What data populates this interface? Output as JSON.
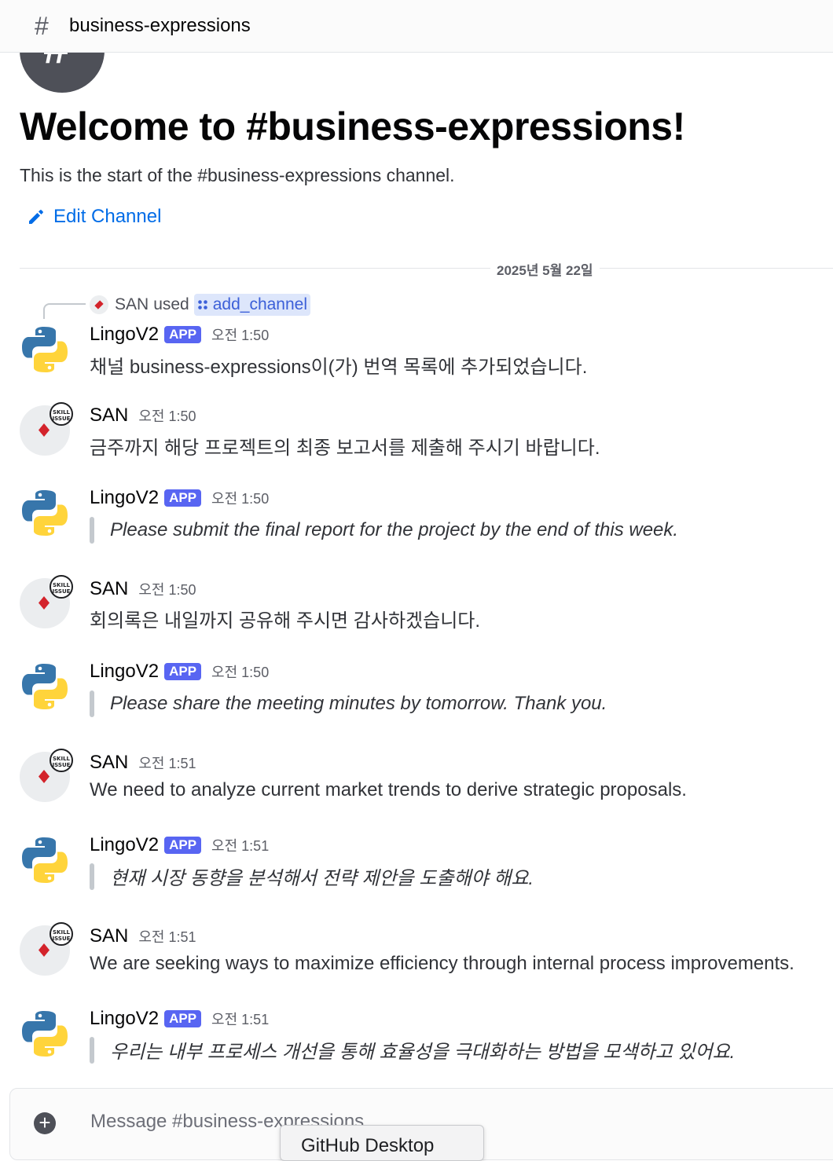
{
  "header": {
    "hash_icon": "hash-icon",
    "channel_name": "business-expressions"
  },
  "welcome": {
    "title": "Welcome to #business-expressions!",
    "subtitle": "This is the start of the #business-expressions channel.",
    "edit_label": "Edit Channel"
  },
  "date_divider": "2025년 5월 22일",
  "command_use": {
    "user": "SAN",
    "verb": "used",
    "command": "add_channel"
  },
  "messages": [
    {
      "author": "LingoV2",
      "badge": "APP",
      "time": "오전 1:50",
      "text": "채널 business-expressions이(가) 번역 목록에 추가되었습니다."
    },
    {
      "author": "SAN",
      "time": "오전 1:50",
      "text": "금주까지 해당 프로젝트의 최종 보고서를 제출해 주시기 바랍니다."
    },
    {
      "author": "LingoV2",
      "badge": "APP",
      "time": "오전 1:50",
      "text": "Please submit the final report for the project by the end of this week."
    },
    {
      "author": "SAN",
      "time": "오전 1:50",
      "text": "회의록은 내일까지 공유해 주시면 감사하겠습니다."
    },
    {
      "author": "LingoV2",
      "badge": "APP",
      "time": "오전 1:50",
      "text": "Please share the meeting minutes by tomorrow. Thank you."
    },
    {
      "author": "SAN",
      "time": "오전 1:51",
      "text": "We need to analyze current market trends to derive strategic proposals."
    },
    {
      "author": "LingoV2",
      "badge": "APP",
      "time": "오전 1:51",
      "text": "현재 시장 동향을 분석해서 전략 제안을 도출해야 해요."
    },
    {
      "author": "SAN",
      "time": "오전 1:51",
      "text": "We are seeking ways to maximize efficiency through internal process improvements."
    },
    {
      "author": "LingoV2",
      "badge": "APP",
      "time": "오전 1:51",
      "text": "우리는 내부 프로세스 개선을 통해 효율성을 극대화하는 방법을 모색하고 있어요."
    }
  ],
  "san_avatar_badge": "SKILL ISSUE",
  "composer": {
    "placeholder": "Message #business-expressions"
  },
  "tooltip": "GitHub Desktop",
  "colors": {
    "app_badge": "#5865f2",
    "link": "#006ce7",
    "quote_bar": "#c4c9ce"
  }
}
